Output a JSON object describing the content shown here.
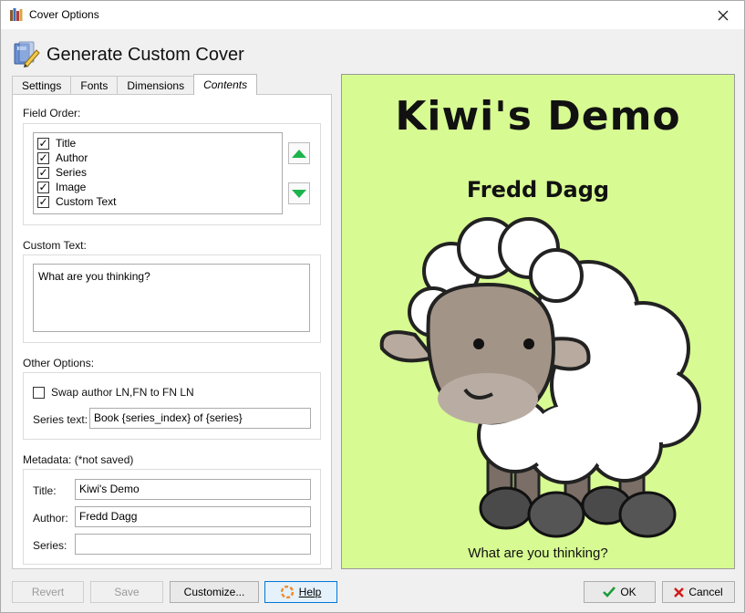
{
  "window": {
    "title": "Cover Options"
  },
  "heading": {
    "text": "Generate Custom Cover"
  },
  "tabs": [
    {
      "label": "Settings",
      "active": false
    },
    {
      "label": "Fonts",
      "active": false
    },
    {
      "label": "Dimensions",
      "active": false
    },
    {
      "label": "Contents",
      "active": true
    }
  ],
  "field_order": {
    "label": "Field Order:",
    "items": [
      {
        "label": "Title",
        "checked": true
      },
      {
        "label": "Author",
        "checked": true
      },
      {
        "label": "Series",
        "checked": true
      },
      {
        "label": "Image",
        "checked": true
      },
      {
        "label": "Custom Text",
        "checked": true
      }
    ]
  },
  "custom_text": {
    "label": "Custom Text:",
    "value": "What are you thinking?"
  },
  "other_options": {
    "label": "Other Options:",
    "swap_label": "Swap author LN,FN to FN LN",
    "swap_checked": false,
    "series_text_label": "Series text:",
    "series_text_value": "Book {series_index} of {series}"
  },
  "metadata": {
    "label": "Metadata: (*not saved)",
    "title_label": "Title:",
    "title_value": "Kiwi's Demo",
    "author_label": "Author:",
    "author_value": "Fredd Dagg",
    "series_label": "Series:",
    "series_value": ""
  },
  "buttons": {
    "revert": "Revert",
    "save": "Save",
    "customize": "Customize...",
    "help": "Help",
    "ok": "OK",
    "cancel": "Cancel"
  },
  "cover": {
    "title": "Kiwi's Demo",
    "author": "Fredd Dagg",
    "custom_text": "What are you thinking?",
    "background": "#d7fa92"
  },
  "colors": {
    "arrow_green": "#1db34c",
    "focus_blue": "#0078d7",
    "ok_check": "#1a9a3a",
    "cancel_x": "#d11a1a",
    "help_orange": "#f28c28"
  }
}
